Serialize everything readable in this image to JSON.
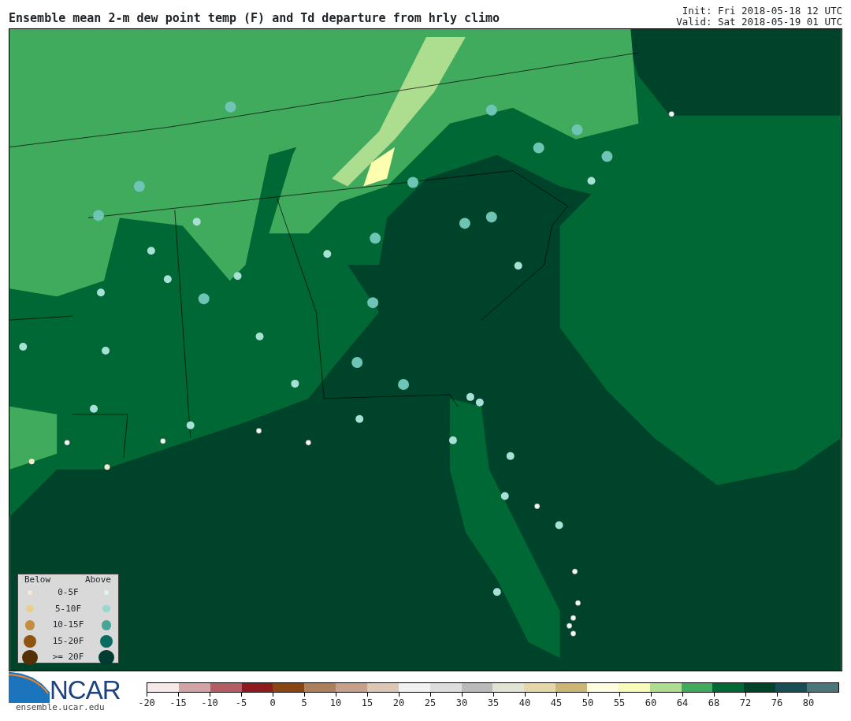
{
  "title": "Ensemble mean 2-m dew point temp (F) and Td departure from hrly climo",
  "init": "Init: Fri 2018-05-18 12 UTC",
  "valid": "Valid: Sat 2018-05-19 01 UTC",
  "legend": {
    "below_heading": "Below",
    "above_heading": "Above",
    "rows": [
      {
        "label": "0-5F",
        "below": {
          "color": "#f5ead0"
        },
        "above": {
          "color": "#dff2ef"
        }
      },
      {
        "label": "5-10F",
        "below": {
          "color": "#e8cf8f"
        },
        "above": {
          "color": "#98d8cd"
        }
      },
      {
        "label": "10-15F",
        "below": {
          "color": "#c48d40"
        },
        "above": {
          "color": "#47a496"
        }
      },
      {
        "label": "15-20F",
        "below": {
          "color": "#8f540f"
        },
        "above": {
          "color": "#0a6c60"
        }
      },
      {
        "label": ">= 20F",
        "below": {
          "color": "#543006"
        },
        "above": {
          "color": "#003c30"
        }
      }
    ]
  },
  "logo": {
    "text": "NCAR",
    "url": "ensemble.ucar.edu"
  },
  "colorbar": {
    "bins": [
      {
        "color": "#f7e9e9"
      },
      {
        "color": "#d4a3a6"
      },
      {
        "color": "#b45d62"
      },
      {
        "color": "#8e1a1e"
      },
      {
        "color": "#8a4513"
      },
      {
        "color": "#ad7f5a"
      },
      {
        "color": "#c7a089"
      },
      {
        "color": "#dec6b5"
      },
      {
        "color": "#f1f1f1"
      },
      {
        "color": "#dddddd"
      },
      {
        "color": "#bababa"
      },
      {
        "color": "#e1e3d3"
      },
      {
        "color": "#e6d7a8"
      },
      {
        "color": "#cdb673"
      },
      {
        "color": "#ffffe0"
      },
      {
        "color": "#f7fcb9"
      },
      {
        "color": "#addd8e"
      },
      {
        "color": "#41ab5d"
      },
      {
        "color": "#006834"
      },
      {
        "color": "#00432b"
      },
      {
        "color": "#1a4e57"
      },
      {
        "color": "#4c777a"
      }
    ],
    "ticks": [
      "-20",
      "-15",
      "-10",
      "-5",
      "0",
      "5",
      "10",
      "15",
      "20",
      "25",
      "30",
      "35",
      "40",
      "45",
      "50",
      "55",
      "60",
      "64",
      "68",
      "72",
      "76",
      "80"
    ]
  }
}
